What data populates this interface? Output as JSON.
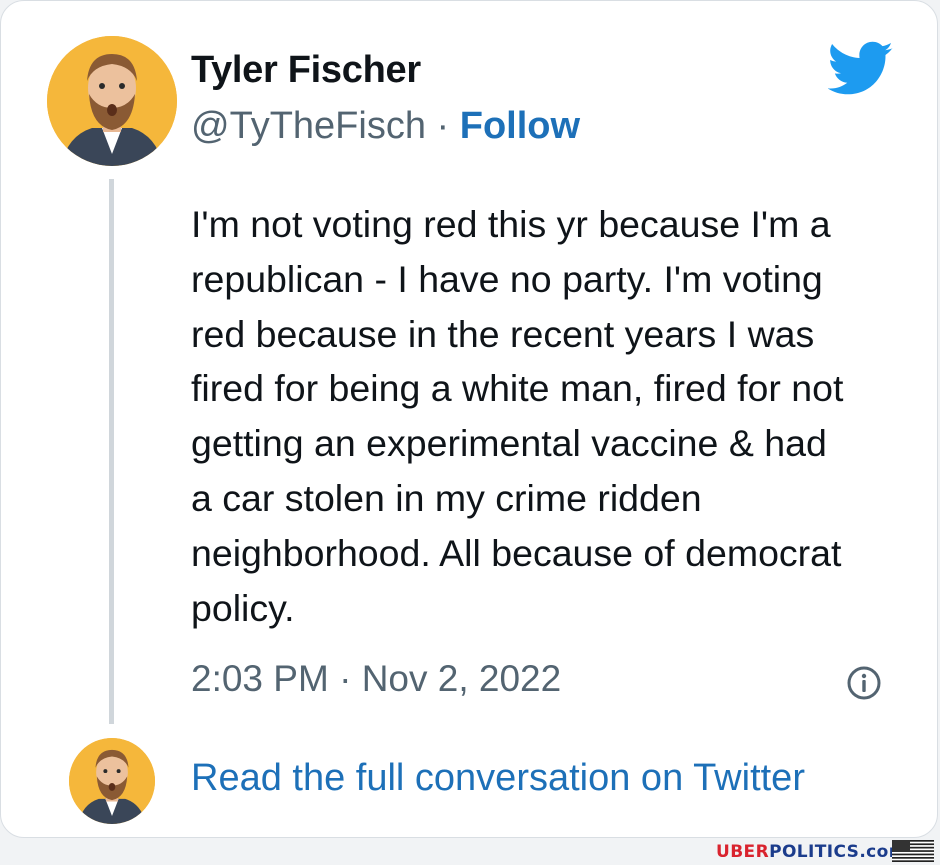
{
  "author": {
    "name": "Tyler Fischer",
    "handle": "@TyTheFisch",
    "separator": "·",
    "follow_label": "Follow"
  },
  "brand_icon": "twitter-bird-icon",
  "tweet": {
    "text": "I'm not voting red this yr because I'm a\nrepublican - I have no party. I'm voting\nred because in the recent years I was\nfired for being a white man, fired for not\ngetting an experimental vaccine & had\na car stolen in my crime ridden\nneighborhood. All because of democrat\npolicy.",
    "time": "2:03 PM",
    "separator": "·",
    "date": "Nov 2, 2022"
  },
  "info_icon": "info-circle-icon",
  "read_full_label": "Read the full conversation on Twitter",
  "watermark": {
    "part1": "UBER",
    "part2": "POLITICS",
    "part3": ".com"
  },
  "colors": {
    "link": "#1d70b8",
    "twitter_blue": "#1d9bf0",
    "text": "#0f1419",
    "muted": "#536471"
  }
}
